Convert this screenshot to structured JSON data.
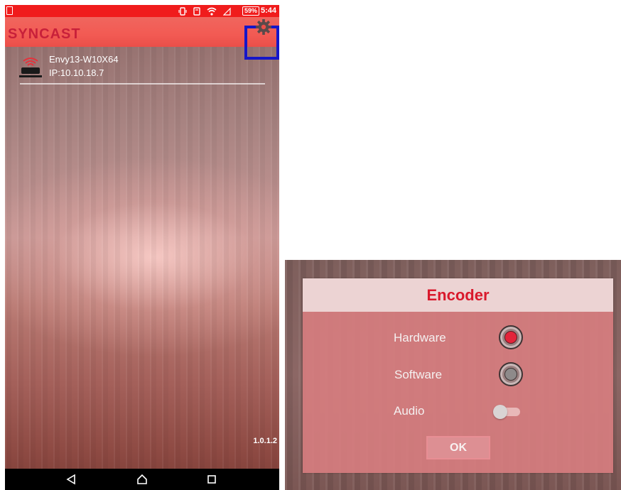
{
  "status_bar": {
    "battery": "59%",
    "time": "5:44",
    "icons": [
      "sim-icon",
      "vibrate-icon",
      "nfc-icon",
      "wifi-icon",
      "signal-icon"
    ]
  },
  "app": {
    "title": "SYNCAST",
    "title_color": "#c8203a",
    "appbar_color": "#f25a53",
    "highlight_color": "#1616c8"
  },
  "device": {
    "name": "Envy13-W10X64",
    "ip": "IP:10.10.18.7",
    "icon": "router-icon"
  },
  "version": "1.0.1.2",
  "navbar": {
    "icons": [
      "back-icon",
      "home-icon",
      "recent-apps-icon"
    ]
  },
  "dialog": {
    "title": "Encoder",
    "title_color": "#d9192c",
    "options": [
      {
        "label": "Hardware",
        "selected": true
      },
      {
        "label": "Software",
        "selected": false
      }
    ],
    "audio": {
      "label": "Audio",
      "enabled": false
    },
    "ok_label": "OK"
  }
}
